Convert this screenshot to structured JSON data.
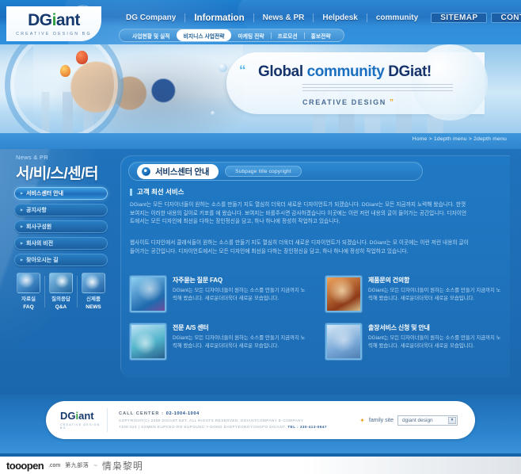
{
  "brand": {
    "logo_dg": "DG",
    "logo_i": "i",
    "logo_ant": "ant",
    "tagline": "CREATIVE DESIGN BG"
  },
  "topnav": {
    "items": [
      {
        "label": "DG Company",
        "active": false
      },
      {
        "label": "Information",
        "active": true
      },
      {
        "label": "News & PR",
        "active": false
      },
      {
        "label": "Helpdesk",
        "active": false
      },
      {
        "label": "community",
        "active": false
      }
    ],
    "pills": [
      {
        "label": "SITEMAP"
      },
      {
        "label": "CONTACT US"
      }
    ]
  },
  "subnav": {
    "items": [
      {
        "label": "사업현황 및 실적",
        "active": false
      },
      {
        "label": "비지니스 사업전략",
        "active": true
      },
      {
        "label": "마케팅 전략",
        "active": false
      },
      {
        "label": "프로모션",
        "active": false
      },
      {
        "label": "홍보전략",
        "active": false
      }
    ]
  },
  "hero": {
    "quote_open": "“",
    "title_a": "Global ",
    "title_b": "community ",
    "title_c": "DGiat!",
    "creative": "CREATIVE DESIGN",
    "quote_close": "”"
  },
  "breadcrumb": {
    "text": "Home > 1depth menu > 2depth menu"
  },
  "sidebar": {
    "eyebrow": "News & PR",
    "title": "서/비/스/센/터",
    "items": [
      {
        "label": "서비스센터 안내",
        "active": true
      },
      {
        "label": "공지사항",
        "active": false
      },
      {
        "label": "회사구성원",
        "active": false
      },
      {
        "label": "회사의 비전",
        "active": false
      },
      {
        "label": "찾아오시는 길",
        "active": false
      }
    ],
    "icons": [
      {
        "name": "faq-icon",
        "ko": "자료실",
        "en": "FAQ"
      },
      {
        "name": "qna-icon",
        "ko": "질의응답",
        "en": "Q&A"
      },
      {
        "name": "news-icon",
        "ko": "신제품",
        "en": "NEWS"
      }
    ]
  },
  "content": {
    "title": "서비스센터 안내",
    "subtitle": "Subpage title copyright",
    "section_heading": "고객 최선 서비스",
    "paragraph1": "DGiant는 모든 디자이너들이 원하는 소스를 만들기 지도 열심히 더욱더 새로운 디자이언트가 되겠습니다. DGiant는 모든 지금까지 노력해 왔습니다. 한껏 보여지는 이러한 내용의 길이로 키포를 에 왔습니다. 보여지는 바를주시면 감사하겠습니다 이곳에는 이런 저런 내용의 글이 들어가는 공간입니다. 디자이언트에서는 모든 디자인에 최선을 다하는 장인정신을 담고, 하나 하나에 정성히 작업하고 있습니다.",
    "paragraph2": "웹사이트 디자인에서 클래식들이 원하는 소스를 만들기 지도 열심히 더욱더 새로운 디자이언트가 되겠습니다. DGiant는 모 이곳에는 이런 저런 내용의 글이 들어가는 공간입니다. 디자이언트에서는 모든 디자인에 최선을 다하는 장인정신을 담고, 하나 하나에 정성히 작업하고 있습니다.",
    "cards": [
      {
        "thumb": "faq-thumb",
        "title": "자주묻는 질문 FAQ",
        "desc": "DGiant는 모든 디자이너들이 원하는 소스를 만들기 지금까지 노력해 왔습니다. 새로운더더욱더 새로운 모습입니다."
      },
      {
        "thumb": "product-inquiry-thumb",
        "title": "제품문의 건의함",
        "desc": "DGiant는 모든 디자이너들이 원하는 소스를 만들기 지금까지 노력해 왔습니다. 새로운더더욱더 새로운 모습입니다."
      },
      {
        "thumb": "as-center-thumb",
        "title": "전문 A/S 센터",
        "desc": "DGiant는 모든 디자이너들이 원하는 소스를 만들기 지금까지 노력해 왔습니다. 새로운더더욱더 새로운 모습입니다."
      },
      {
        "thumb": "visit-service-thumb",
        "title": "출장서비스 신청 및 안내",
        "desc": "DGiant는 모든 디자이너들이 원하는 소스를 만들기 지금까지 노력해 왔습니다. 새로운더더욱더 새로운 모습입니다."
      }
    ]
  },
  "footer": {
    "logo_dg": "DG",
    "logo_i": "i",
    "logo_ant": "ant",
    "logo_sub": "CREATIVE DESIGN BG",
    "call_label": "CALL CENTER :",
    "call_number": "02-1004-1004",
    "copyright": "COPYRIGHT(C) 2009 DGIANT.NET. ALL RIGHTS RESERVED. DGIANTCOMPANY E-COMPANY",
    "address": "7400-024 | SOMEN EUPCEO-RO EUPGUNC Y-DONG DAEPYEONGYONGPO DGIANT.",
    "tel_label": "TEL :",
    "tel_number": "330-413-0947",
    "family_label": "family site",
    "family_value": "dgiant design",
    "family_caret": "▼"
  },
  "watermark": {
    "logo": "tooopen",
    "domain": ".com",
    "cn_site": "第九部落",
    "tilde": "~",
    "title": "情枭黎明"
  },
  "colors": {
    "header_blue": "#1a6fc0",
    "body_blue": "#1f72bb",
    "accent_light": "#6fb5e6",
    "logo_green": "#2f9c3f",
    "logo_navy": "#173a6e",
    "star_orange": "#f0a020"
  }
}
